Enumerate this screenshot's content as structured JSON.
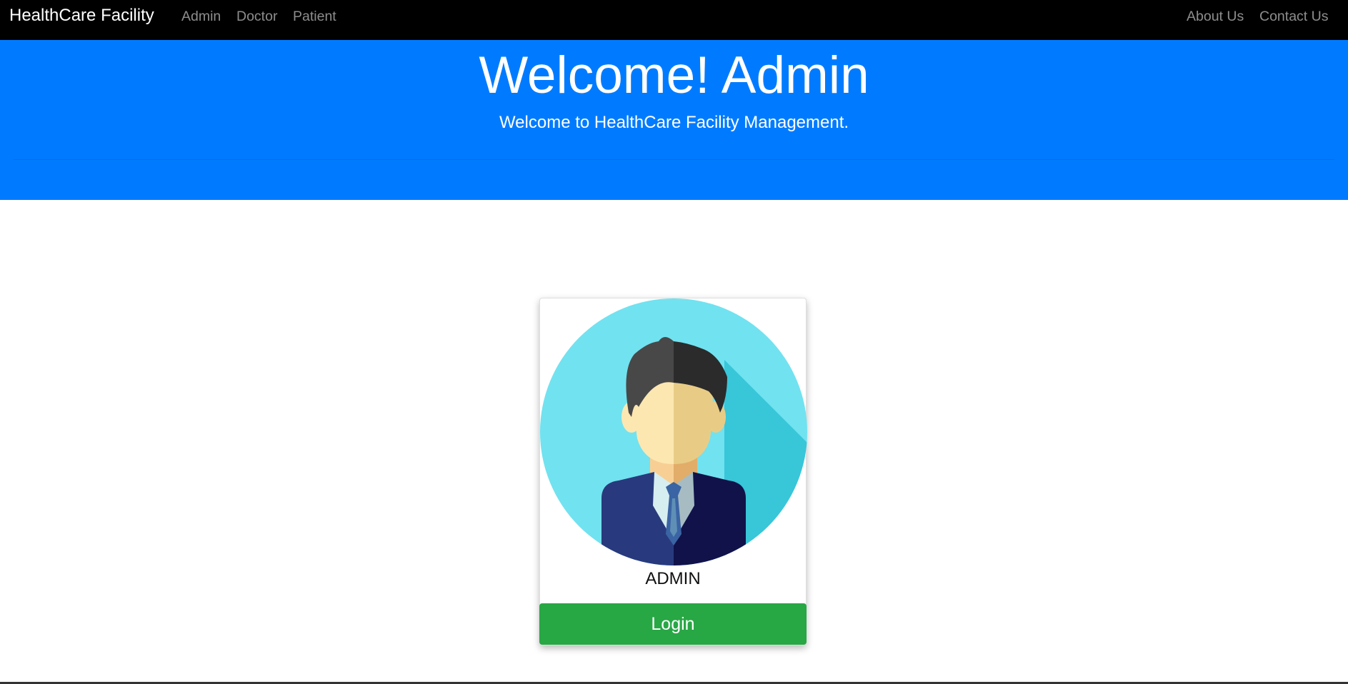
{
  "navbar": {
    "brand": "HealthCare Facility",
    "left_links": [
      "Admin",
      "Doctor",
      "Patient"
    ],
    "right_links": [
      "About Us",
      "Contact Us"
    ]
  },
  "hero": {
    "title": "Welcome! Admin",
    "subtitle": "Welcome to HealthCare Facility Management."
  },
  "card": {
    "avatar_icon": "admin-avatar-icon",
    "title": "ADMIN",
    "button_label": "Login"
  },
  "colors": {
    "navbar_bg": "#000000",
    "hero_bg": "#007bff",
    "login_button": "#28a745",
    "avatar_bg": "#71e2f0"
  }
}
